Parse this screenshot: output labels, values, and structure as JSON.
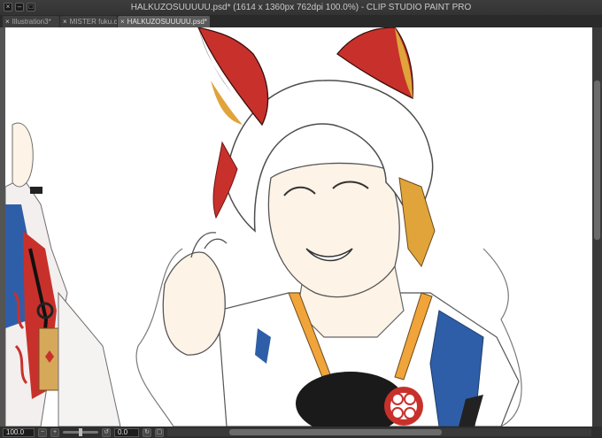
{
  "window": {
    "title": "HALKUZOSUUUUU.psd* (1614 x 1360px 762dpi 100.0%)  - CLIP STUDIO PAINT PRO",
    "buttons": [
      "×",
      "–",
      "□"
    ]
  },
  "tabs": [
    {
      "label": "Illustration3*",
      "close": "×",
      "active": false
    },
    {
      "label": "MISTER fuku.c",
      "close": "×",
      "active": false
    },
    {
      "label": "HALKUZOSUUUUU.psd*",
      "close": "×",
      "active": true
    }
  ],
  "statusbar": {
    "zoom": "100.0",
    "angle": "0.0"
  },
  "colors": {
    "ear_red": "#c8312b",
    "ear_orange": "#e0a43a",
    "skin": "#fdf3e7",
    "scarf_blue": "#2f5ea8",
    "collar_orange": "#f0a43a"
  }
}
